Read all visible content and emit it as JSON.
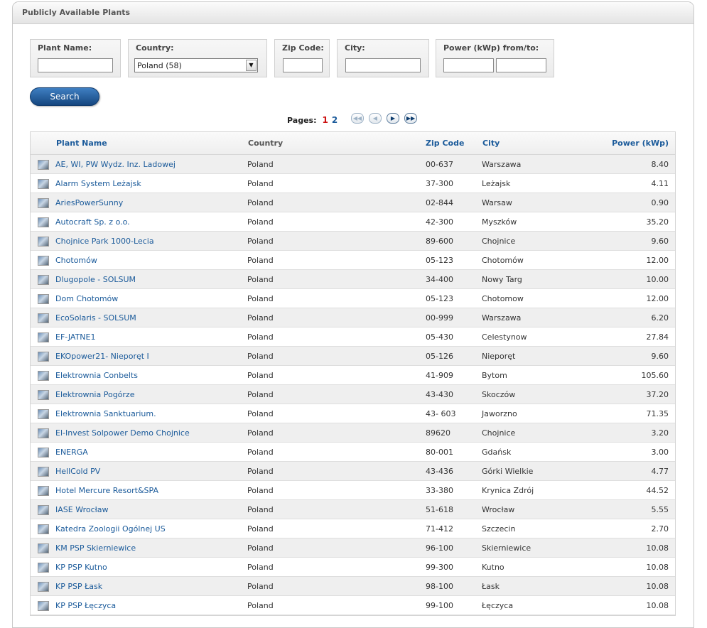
{
  "panel": {
    "title": "Publicly Available Plants"
  },
  "filters": {
    "plant_name_label": "Plant Name:",
    "plant_name_value": "",
    "country_label": "Country:",
    "country_selected": "Poland (58)",
    "zip_label": "Zip Code:",
    "zip_value": "",
    "city_label": "City:",
    "city_value": "",
    "power_label": "Power (kWp) from/to:",
    "power_from": "",
    "power_to": ""
  },
  "search_label": "Search",
  "pagination": {
    "label": "Pages:",
    "pages": [
      "1",
      "2"
    ],
    "current": "1",
    "icons": [
      "first-page-icon",
      "prev-page-icon",
      "next-page-icon",
      "last-page-icon"
    ]
  },
  "table": {
    "headers": {
      "name": "Plant Name",
      "country": "Country",
      "zip": "Zip Code",
      "city": "City",
      "power": "Power (kWp)"
    },
    "rows": [
      {
        "name": "AE, WI, PW Wydz. Inz. Ladowej",
        "country": "Poland",
        "zip": "00-637",
        "city": "Warszawa",
        "power": "8.40"
      },
      {
        "name": "Alarm System Leżajsk",
        "country": "Poland",
        "zip": "37-300",
        "city": "Leżajsk",
        "power": "4.11"
      },
      {
        "name": "AriesPowerSunny",
        "country": "Poland",
        "zip": "02-844",
        "city": "Warsaw",
        "power": "0.90"
      },
      {
        "name": "Autocraft Sp. z o.o.",
        "country": "Poland",
        "zip": "42-300",
        "city": "Myszków",
        "power": "35.20"
      },
      {
        "name": "Chojnice Park 1000-Lecia",
        "country": "Poland",
        "zip": "89-600",
        "city": "Chojnice",
        "power": "9.60"
      },
      {
        "name": "Chotomów",
        "country": "Poland",
        "zip": "05-123",
        "city": "Chotomów",
        "power": "12.00"
      },
      {
        "name": "Dlugopole - SOLSUM",
        "country": "Poland",
        "zip": "34-400",
        "city": "Nowy Targ",
        "power": "10.00"
      },
      {
        "name": "Dom Chotomów",
        "country": "Poland",
        "zip": "05-123",
        "city": "Chotomow",
        "power": "12.00"
      },
      {
        "name": "EcoSolaris - SOLSUM",
        "country": "Poland",
        "zip": "00-999",
        "city": "Warszawa",
        "power": "6.20"
      },
      {
        "name": "EF-JATNE1",
        "country": "Poland",
        "zip": "05-430",
        "city": "Celestynow",
        "power": "27.84"
      },
      {
        "name": "EKOpower21- Nieporęt I",
        "country": "Poland",
        "zip": "05-126",
        "city": "Nieporęt",
        "power": "9.60"
      },
      {
        "name": "Elektrownia Conbelts",
        "country": "Poland",
        "zip": "41-909",
        "city": "Bytom",
        "power": "105.60"
      },
      {
        "name": "Elektrownia Pogórze",
        "country": "Poland",
        "zip": "43-430",
        "city": "Skoczów",
        "power": "37.20"
      },
      {
        "name": "Elektrownia Sanktuarium.",
        "country": "Poland",
        "zip": "43- 603",
        "city": "Jaworzno",
        "power": "71.35"
      },
      {
        "name": "El-Invest Solpower Demo Chojnice",
        "country": "Poland",
        "zip": "89620",
        "city": "Chojnice",
        "power": "3.20"
      },
      {
        "name": "ENERGA",
        "country": "Poland",
        "zip": "80-001",
        "city": "Gdańsk",
        "power": "3.00"
      },
      {
        "name": "HellCold PV",
        "country": "Poland",
        "zip": "43-436",
        "city": "Górki Wielkie",
        "power": "4.77"
      },
      {
        "name": "Hotel Mercure Resort&SPA",
        "country": "Poland",
        "zip": "33-380",
        "city": "Krynica Zdrój",
        "power": "44.52"
      },
      {
        "name": "IASE Wrocław",
        "country": "Poland",
        "zip": "51-618",
        "city": "Wrocław",
        "power": "5.55"
      },
      {
        "name": "Katedra Zoologii Ogólnej US",
        "country": "Poland",
        "zip": "71-412",
        "city": "Szczecin",
        "power": "2.70"
      },
      {
        "name": "KM PSP Skierniewice",
        "country": "Poland",
        "zip": "96-100",
        "city": "Skierniewice",
        "power": "10.08"
      },
      {
        "name": "KP PSP Kutno",
        "country": "Poland",
        "zip": "99-300",
        "city": "Kutno",
        "power": "10.08"
      },
      {
        "name": "KP PSP Łask",
        "country": "Poland",
        "zip": "98-100",
        "city": "Łask",
        "power": "10.08"
      },
      {
        "name": "KP PSP Łęczyca",
        "country": "Poland",
        "zip": "99-100",
        "city": "Łęczyca",
        "power": "10.08"
      }
    ]
  }
}
